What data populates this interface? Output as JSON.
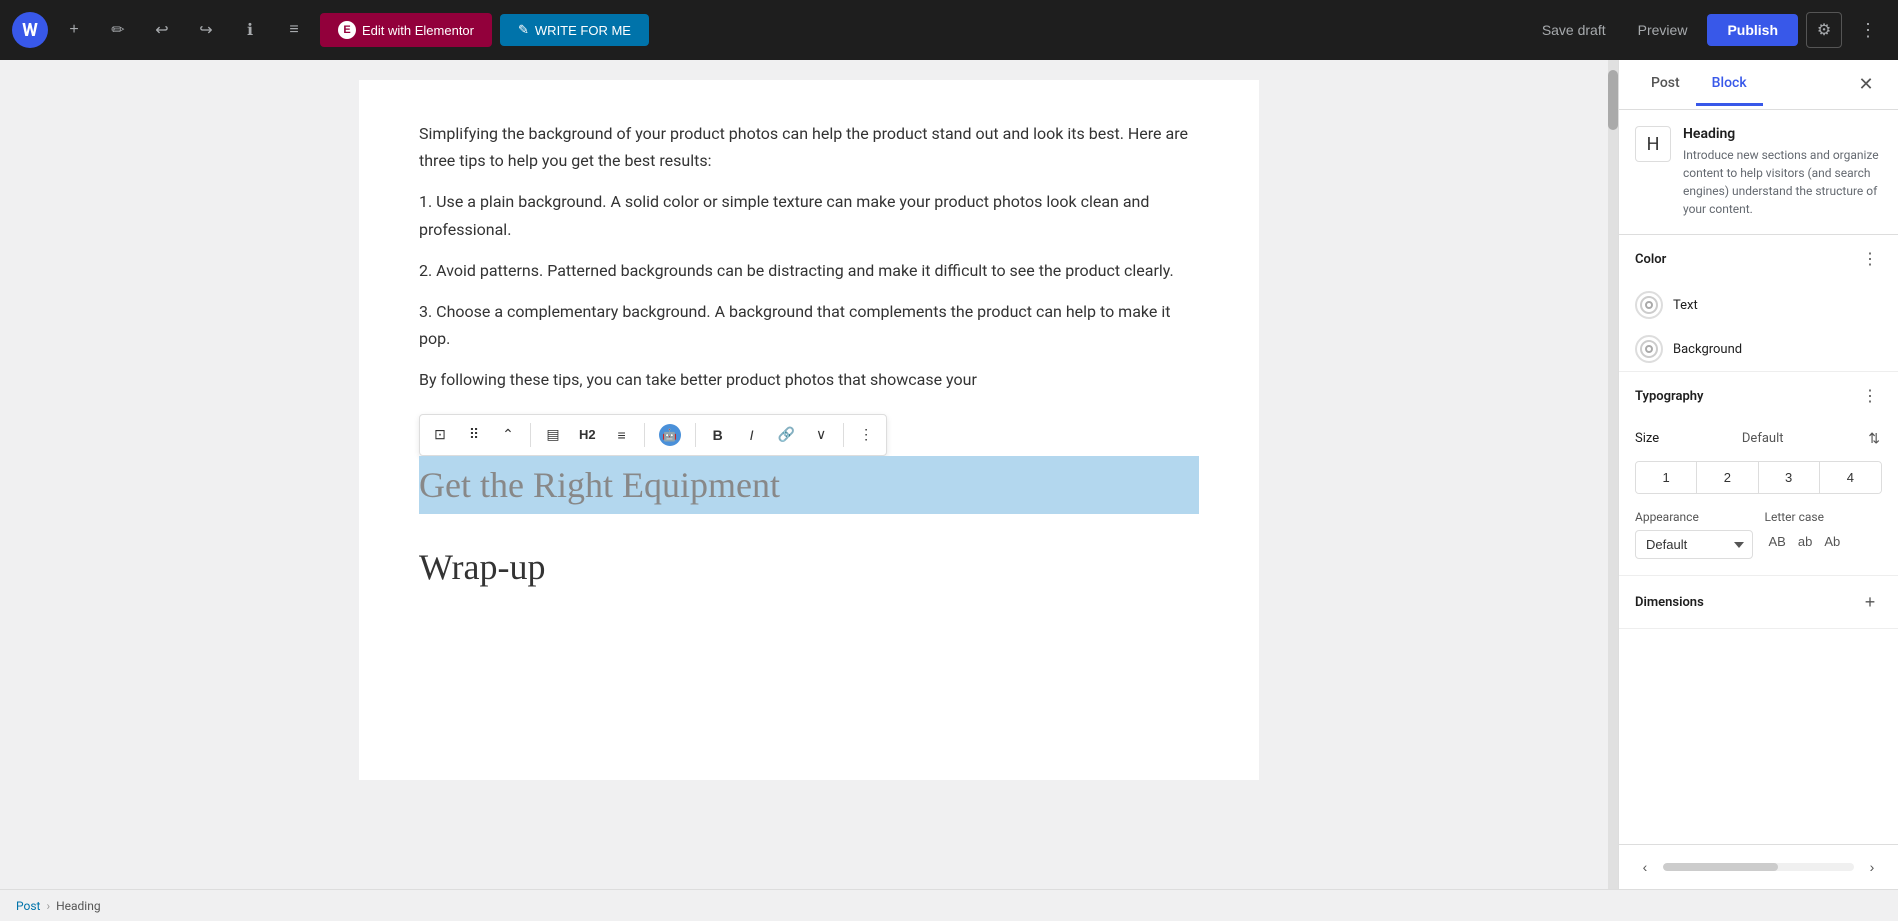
{
  "topbar": {
    "wp_logo": "W",
    "add_label": "+",
    "pencil_label": "✏",
    "undo_label": "↩",
    "redo_label": "↪",
    "info_label": "ℹ",
    "menu_label": "≡",
    "elementor_btn": "Edit with Elementor",
    "write_for_me_btn": "WRITE FOR ME",
    "save_draft_label": "Save draft",
    "preview_label": "Preview",
    "publish_label": "Publish",
    "settings_label": "⚙",
    "more_options_label": "⋮"
  },
  "editor": {
    "content": [
      "Simplifying the background of your product photos can help the product stand out and look its best. Here are three tips to help you get the best results:",
      "1. Use a plain background. A solid color or simple texture can make your product photos look clean and professional.",
      "2. Avoid patterns. Patterned backgrounds can be distracting and make it difficult to see the product clearly.",
      "3. Choose a complementary background. A background that complements the product can help to make it pop.",
      "By following these tips, you can take better product photos that showcase your"
    ],
    "selected_heading": "Get the Right Equipment",
    "wrap_up_heading": "Wrap-up"
  },
  "block_toolbar": {
    "bookmark_label": "🔖",
    "drag_label": "⠿",
    "move_label": "⌃",
    "align_label": "▤",
    "h2_label": "H2",
    "text_align_label": "≡",
    "robot_label": "🤖",
    "bold_label": "B",
    "italic_label": "I",
    "link_label": "🔗",
    "more_label": "∨",
    "options_label": "⋮"
  },
  "sidebar": {
    "post_tab": "Post",
    "block_tab": "Block",
    "close_label": "✕",
    "block_icon": "H",
    "block_title": "Heading",
    "block_description": "Introduce new sections and organize content to help visitors (and search engines) understand the structure of your content.",
    "color_section": {
      "title": "Color",
      "more_label": "⋮",
      "text_option": "Text",
      "background_option": "Background"
    },
    "typography_section": {
      "title": "Typography",
      "more_label": "⋮",
      "size_label": "Size",
      "size_default": "Default",
      "size_adjust_label": "⇅",
      "sizes": [
        "1",
        "2",
        "3",
        "4"
      ],
      "appearance_label": "Appearance",
      "appearance_value": "Default",
      "letter_case_label": "Letter case",
      "letter_cases": [
        "AB",
        "ab",
        "Ab"
      ]
    },
    "dimensions_section": {
      "title": "Dimensions",
      "add_label": "+"
    }
  },
  "breadcrumb": {
    "post_label": "Post",
    "separator": "›",
    "heading_label": "Heading"
  },
  "sidebar_bottom": {
    "prev_label": "‹",
    "next_label": "›"
  }
}
